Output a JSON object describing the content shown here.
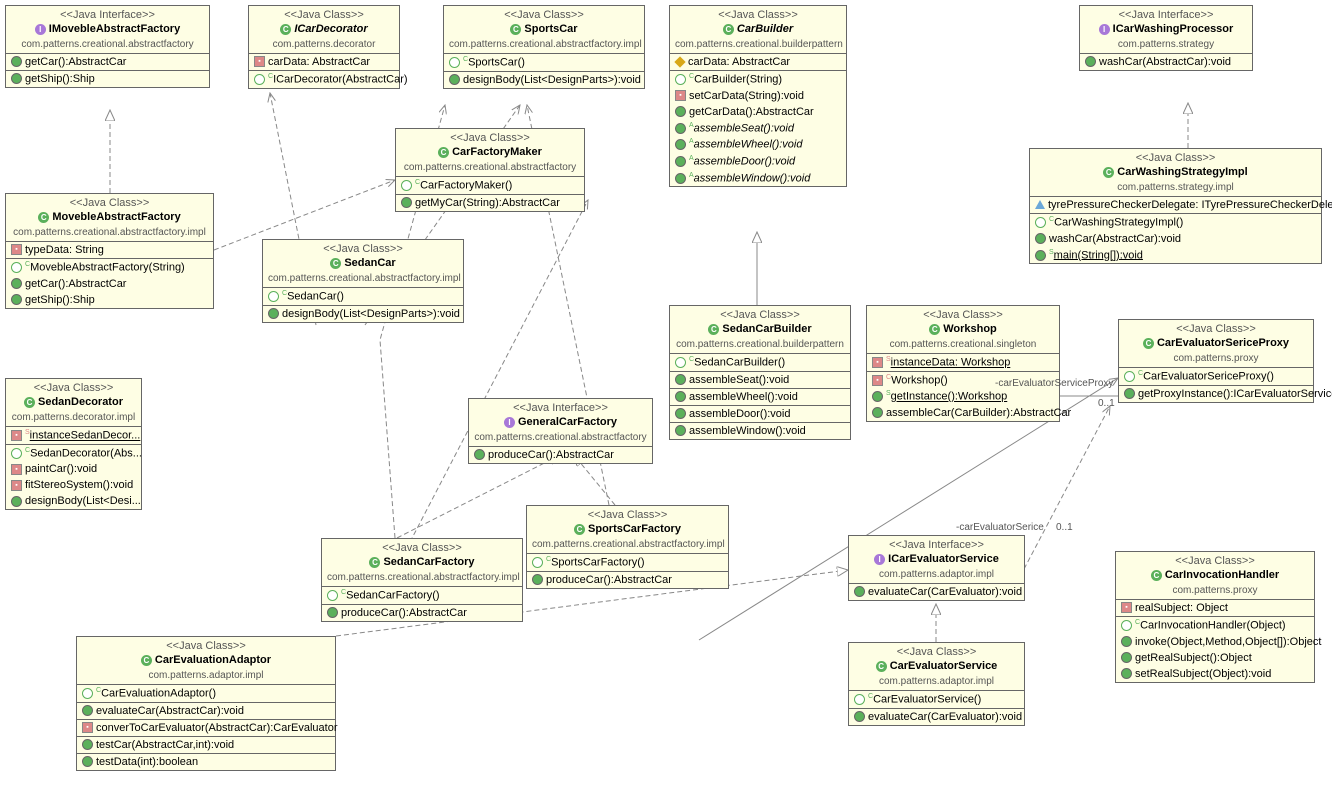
{
  "stereotypes": {
    "intf": "<<Java Interface>>",
    "cls": "<<Java Class>>"
  },
  "c": {
    "IMovebleAbstractFactory": {
      "s": "intf",
      "n": "IMovebleAbstractFactory",
      "p": "com.patterns.creational.abstractfactory",
      "m": [
        "getCar():AbstractCar",
        "getShip():Ship"
      ]
    },
    "ICarDecorator": {
      "s": "cls",
      "n": "ICarDecorator",
      "p": "com.patterns.decorator",
      "a": [
        "carData: AbstractCar"
      ],
      "m": [
        "ICarDecorator(AbstractCar)"
      ]
    },
    "SportsCar": {
      "s": "cls",
      "n": "SportsCar",
      "p": "com.patterns.creational.abstractfactory.impl",
      "m": [
        "SportsCar()",
        "designBody(List<DesignParts>):void"
      ]
    },
    "CarBuilder": {
      "s": "cls",
      "n": "CarBuilder",
      "p": "com.patterns.creational.builderpattern"
    },
    "ICarWashingProcessor": {
      "s": "intf",
      "n": "ICarWashingProcessor",
      "p": "com.patterns.strategy",
      "m": [
        "washCar(AbstractCar):void"
      ]
    },
    "MovebleAbstractFactory": {
      "s": "cls",
      "n": "MovebleAbstractFactory",
      "p": "com.patterns.creational.abstractfactory.impl",
      "a": [
        "typeData: String"
      ],
      "m": [
        "MovebleAbstractFactory(String)",
        "getCar():AbstractCar",
        "getShip():Ship"
      ]
    },
    "CarFactoryMaker": {
      "s": "cls",
      "n": "CarFactoryMaker",
      "p": "com.patterns.creational.abstractfactory",
      "m": [
        "CarFactoryMaker()",
        "getMyCar(String):AbstractCar"
      ]
    },
    "CarWashingStrategyImpl": {
      "s": "cls",
      "n": "CarWashingStrategyImpl",
      "p": "com.patterns.strategy.impl"
    },
    "SedanCar": {
      "s": "cls",
      "n": "SedanCar",
      "p": "com.patterns.creational.abstractfactory.impl",
      "m": [
        "SedanCar()",
        "designBody(List<DesignParts>):void"
      ]
    },
    "SedanCarBuilder": {
      "s": "cls",
      "n": "SedanCarBuilder",
      "p": "com.patterns.creational.builderpattern",
      "m": [
        "SedanCarBuilder()",
        "assembleSeat():void",
        "assembleWheel():void",
        "assembleDoor():void",
        "assembleWindow():void"
      ]
    },
    "Workshop": {
      "s": "cls",
      "n": "Workshop",
      "p": "com.patterns.creational.singleton"
    },
    "CarEvaluatorSericeProxy": {
      "s": "cls",
      "n": "CarEvaluatorSericeProxy",
      "p": "com.patterns.proxy",
      "m": [
        "CarEvaluatorSericeProxy()",
        "getProxyInstance():ICarEvaluatorService"
      ]
    },
    "SedanDecorator": {
      "s": "cls",
      "n": "SedanDecorator",
      "p": "com.patterns.decorator.impl"
    },
    "GeneralCarFactory": {
      "s": "intf",
      "n": "GeneralCarFactory",
      "p": "com.patterns.creational.abstractfactory",
      "m": [
        "produceCar():AbstractCar"
      ]
    },
    "SportsCarFactory": {
      "s": "cls",
      "n": "SportsCarFactory",
      "p": "com.patterns.creational.abstractfactory.impl",
      "m": [
        "SportsCarFactory()",
        "produceCar():AbstractCar"
      ]
    },
    "ICarEvaluatorService": {
      "s": "intf",
      "n": "ICarEvaluatorService",
      "p": "com.patterns.adaptor.impl",
      "m": [
        "evaluateCar(CarEvaluator):void"
      ]
    },
    "CarInvocationHandler": {
      "s": "cls",
      "n": "CarInvocationHandler",
      "p": "com.patterns.proxy"
    },
    "SedanCarFactory": {
      "s": "cls",
      "n": "SedanCarFactory",
      "p": "com.patterns.creational.abstractfactory.impl",
      "m": [
        "SedanCarFactory()",
        "produceCar():AbstractCar"
      ]
    },
    "CarEvaluationAdaptor": {
      "s": "cls",
      "n": "CarEvaluationAdaptor",
      "p": "com.patterns.adaptor.impl"
    },
    "CarEvaluatorService": {
      "s": "cls",
      "n": "CarEvaluatorService",
      "p": "com.patterns.adaptor.impl",
      "m": [
        "CarEvaluatorService()",
        "evaluateCar(CarEvaluator):void"
      ]
    }
  },
  "l": {
    "cesp": "-carEvaluatorServiceProxy",
    "n01": "0..1",
    "ces": "-carEvaluatorSerice"
  }
}
